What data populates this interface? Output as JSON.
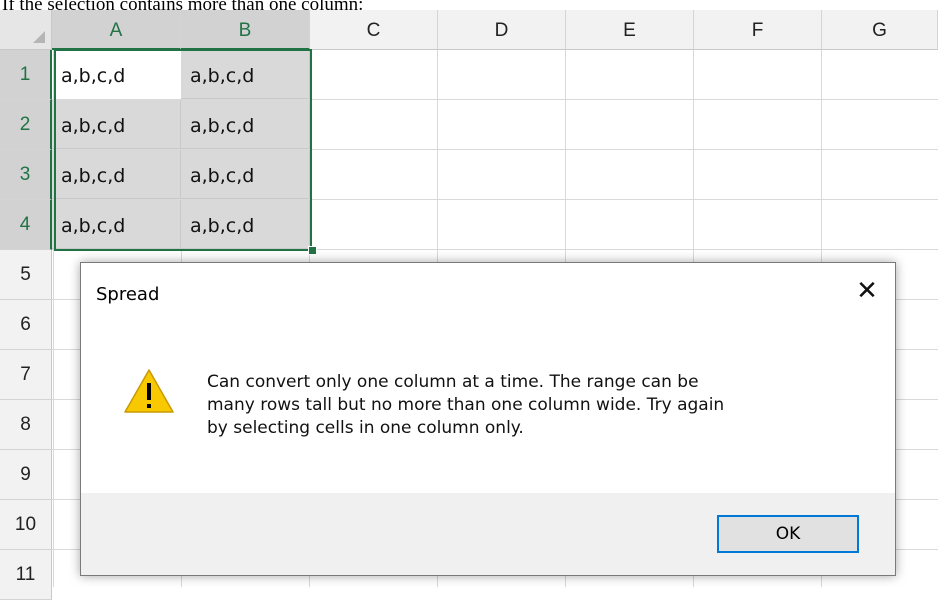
{
  "caption": "If the selection contains more than one column:",
  "columns": [
    "A",
    "B",
    "C",
    "D",
    "E",
    "F",
    "G"
  ],
  "rows": [
    "1",
    "2",
    "3",
    "4",
    "5",
    "6",
    "7",
    "8",
    "9",
    "10",
    "11"
  ],
  "cells": {
    "A1": "a,b,c,d",
    "B1": "a,b,c,d",
    "A2": "a,b,c,d",
    "B2": "a,b,c,d",
    "A3": "a,b,c,d",
    "B3": "a,b,c,d",
    "A4": "a,b,c,d",
    "B4": "a,b,c,d"
  },
  "dialog": {
    "title": "Spread",
    "close_glyph": "✕",
    "icon": "warning-icon",
    "message_lines": [
      "Can convert only one column at a time. The range can be",
      "many rows tall but no more than one column wide. Try again",
      "by selecting cells in one column only."
    ],
    "ok_label": "OK"
  },
  "colors": {
    "selection": "#217346",
    "ok_border": "#0078d7",
    "warning": "#f8c800"
  }
}
